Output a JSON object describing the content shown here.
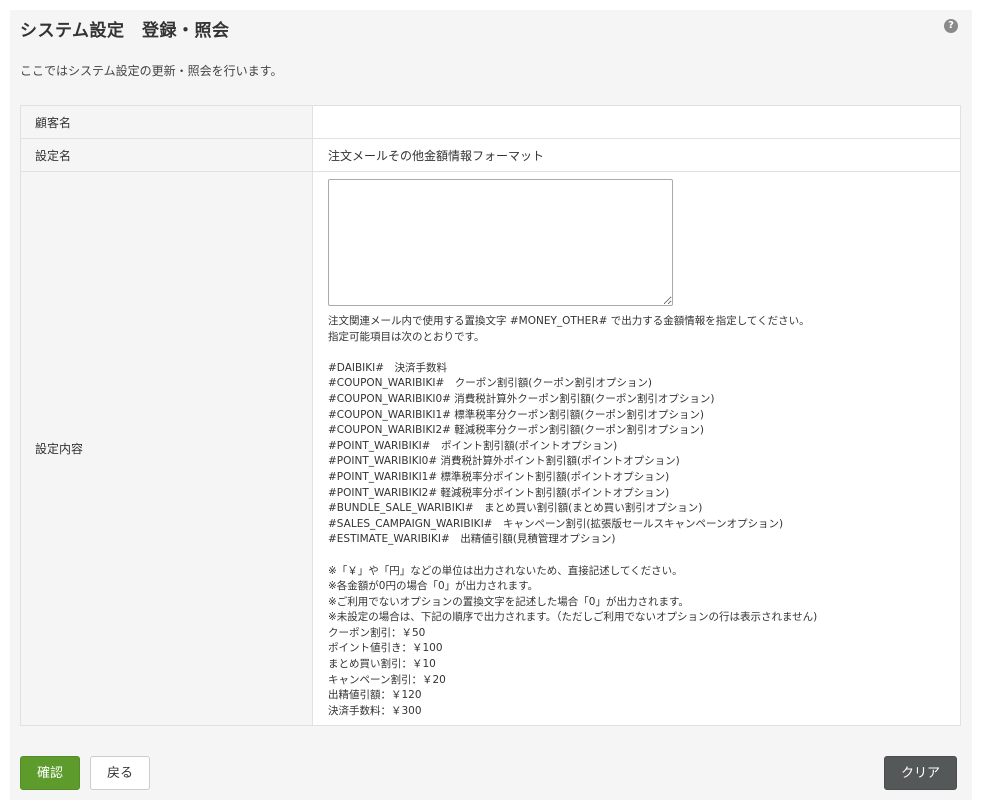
{
  "header": {
    "title": "システム設定　登録・照会",
    "help_icon": "?",
    "description": "ここではシステム設定の更新・照会を行います。"
  },
  "form": {
    "rows": [
      {
        "label": "顧客名",
        "value": ""
      },
      {
        "label": "設定名",
        "value": "注文メールその他金額情報フォーマット"
      },
      {
        "label": "設定内容",
        "value": ""
      }
    ],
    "textarea_value": "",
    "help_lines": [
      "注文関連メール内で使用する置換文字 #MONEY_OTHER# で出力する金額情報を指定してください。",
      "指定可能項目は次のとおりです。",
      "",
      "#DAIBIKI#　決済手数料",
      "#COUPON_WARIBIKI#　クーポン割引額(クーポン割引オプション)",
      "#COUPON_WARIBIKI0# 消費税計算外クーポン割引額(クーポン割引オプション)",
      "#COUPON_WARIBIKI1# 標準税率分クーポン割引額(クーポン割引オプション)",
      "#COUPON_WARIBIKI2# 軽減税率分クーポン割引額(クーポン割引オプション)",
      "#POINT_WARIBIKI#　ポイント割引額(ポイントオプション)",
      "#POINT_WARIBIKI0# 消費税計算外ポイント割引額(ポイントオプション)",
      "#POINT_WARIBIKI1# 標準税率分ポイント割引額(ポイントオプション)",
      "#POINT_WARIBIKI2# 軽減税率分ポイント割引額(ポイントオプション)",
      "#BUNDLE_SALE_WARIBIKI#　まとめ買い割引額(まとめ買い割引オプション)",
      "#SALES_CAMPAIGN_WARIBIKI#　キャンペーン割引(拡張版セールスキャンペーンオプション)",
      "#ESTIMATE_WARIBIKI#　出精値引額(見積管理オプション)",
      "",
      "※「￥」や「円」などの単位は出力されないため、直接記述してください。",
      "※各金額が0円の場合「0」が出力されます。",
      "※ご利用でないオプションの置換文字を記述した場合「0」が出力されます。",
      "※未設定の場合は、下記の順序で出力されます。（ただしご利用でないオプションの行は表示されません)",
      "クーポン割引：￥50",
      "ポイント値引き：￥100",
      "まとめ買い割引：￥10",
      "キャンペーン割引：￥20",
      "出精値引額：￥120",
      "決済手数料：￥300"
    ]
  },
  "buttons": {
    "confirm": "確認",
    "back": "戻る",
    "clear": "クリア"
  },
  "colors": {
    "confirm_bg": "#5e9b2d",
    "clear_bg": "#545859",
    "panel_bg": "#f5f5f6"
  }
}
